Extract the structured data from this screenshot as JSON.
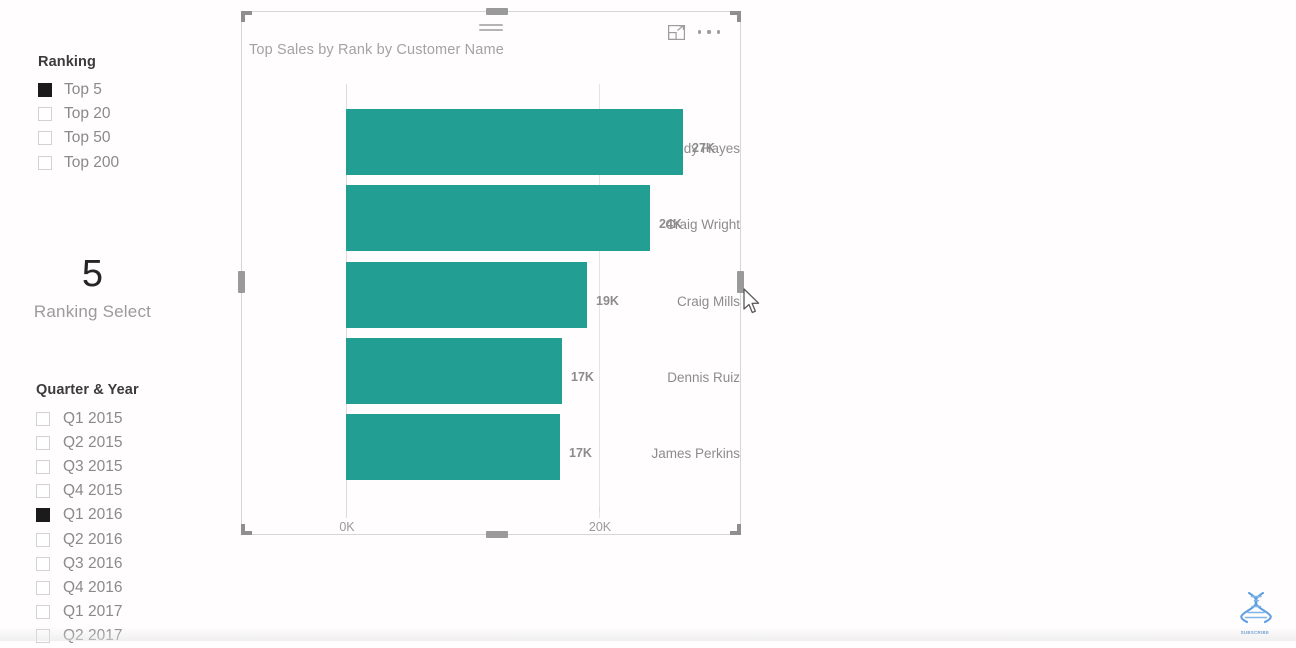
{
  "ranking_slicer": {
    "title": "Ranking",
    "items": [
      {
        "label": "Top 5",
        "checked": true
      },
      {
        "label": "Top 20",
        "checked": false
      },
      {
        "label": "Top 50",
        "checked": false
      },
      {
        "label": "Top 200",
        "checked": false
      }
    ]
  },
  "card": {
    "value": "5",
    "label": "Ranking Select"
  },
  "quarter_slicer": {
    "title": "Quarter & Year",
    "items": [
      {
        "label": "Q1 2015",
        "checked": false
      },
      {
        "label": "Q2 2015",
        "checked": false
      },
      {
        "label": "Q3 2015",
        "checked": false
      },
      {
        "label": "Q4 2015",
        "checked": false
      },
      {
        "label": "Q1 2016",
        "checked": true
      },
      {
        "label": "Q2 2016",
        "checked": false
      },
      {
        "label": "Q3 2016",
        "checked": false
      },
      {
        "label": "Q4 2016",
        "checked": false
      },
      {
        "label": "Q1 2017",
        "checked": false
      },
      {
        "label": "Q2 2017",
        "checked": false
      }
    ]
  },
  "visual": {
    "title": "Top Sales by Rank by Customer Name",
    "focus_icon": "focus-mode-icon",
    "more_icon": "more-options-icon",
    "drag_icon": "drag-handle-icon",
    "accent_color": "#229e92"
  },
  "watermark": {
    "label": "SUBSCRIBE",
    "icon": "dna-helix-icon",
    "color": "#4f8fd0"
  },
  "cursor": {
    "icon": "arrow-cursor-icon"
  },
  "chart_data": {
    "type": "bar",
    "orientation": "horizontal",
    "title": "Top Sales by Rank by Customer Name",
    "xlabel": "",
    "ylabel": "",
    "categories": [
      "Randy Hayes",
      "Craig Wright",
      "Craig Mills",
      "Dennis Ruiz",
      "James Perkins"
    ],
    "values": [
      27000,
      24000,
      19000,
      17000,
      17000
    ],
    "data_labels": [
      "27K",
      "24K",
      "19K",
      "17K",
      "17K"
    ],
    "xlim": [
      0,
      27000
    ],
    "axis_ticks": [
      {
        "value": 0,
        "label": "0K"
      },
      {
        "value": 20000,
        "label": "20K"
      }
    ],
    "grid": true,
    "legend": "none",
    "series_color": "#229e92"
  }
}
